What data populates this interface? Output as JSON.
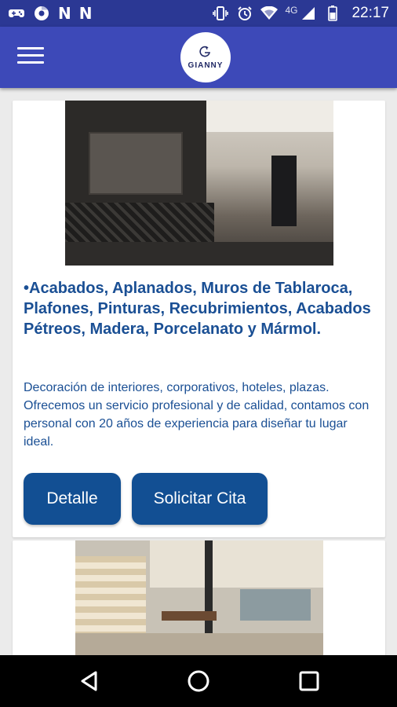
{
  "status_bar": {
    "network": "4G",
    "time": "22:17",
    "icons": [
      "game-controller-icon",
      "chrome-icon",
      "n-app-icon",
      "n-app-icon",
      "vibrate-icon",
      "alarm-icon",
      "wifi-icon",
      "signal-icon",
      "battery-icon"
    ]
  },
  "app_bar": {
    "logo_text": "GIANNY",
    "menu_icon": "hamburger-menu-icon"
  },
  "cards": [
    {
      "image": "modern-bathroom-photo",
      "title": "•Acabados, Aplanados, Muros de Tablaroca, Plafones, Pinturas, Recubrimientos, Acabados Pétreos, Madera, Porcelanato y Mármol.",
      "description": "Decoración de interiores, corporativos, hoteles, plazas. Ofrecemos un servicio profesional y de calidad, contamos con personal con 20 años de experiencia para diseñar tu lugar ideal.",
      "buttons": {
        "detail": "Detalle",
        "appointment": "Solicitar Cita"
      }
    },
    {
      "image": "restaurant-interior-photo"
    }
  ],
  "nav_bar": {
    "icons": [
      "back-icon",
      "home-icon",
      "recents-icon"
    ]
  },
  "colors": {
    "status_bar": "#2b3894",
    "app_bar": "#3d49b8",
    "accent": "#124f93",
    "text": "#1a4f94"
  }
}
